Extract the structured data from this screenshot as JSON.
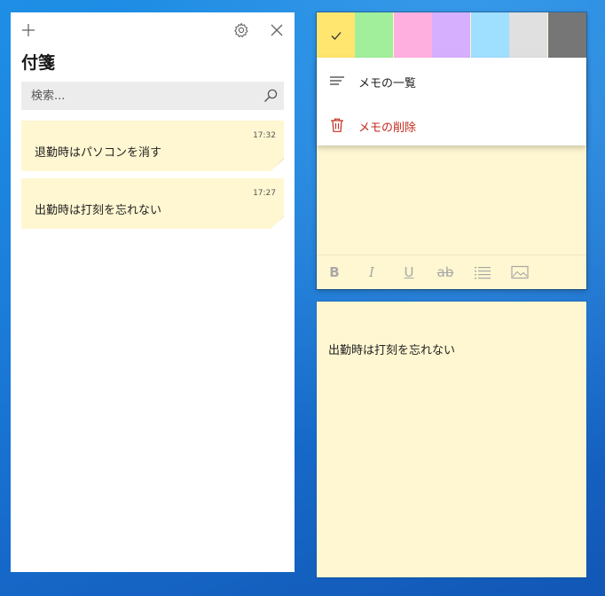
{
  "list_panel": {
    "title": "付箋",
    "search": {
      "placeholder": "検索...",
      "value": ""
    },
    "notes": [
      {
        "text": "退勤時はパソコンを消す",
        "time": "17:32"
      },
      {
        "text": "出勤時は打刻を忘れない",
        "time": "17:27"
      }
    ]
  },
  "edit_note": {
    "colors": [
      {
        "name": "yellow",
        "hex": "#ffe66e",
        "selected": true
      },
      {
        "name": "green",
        "hex": "#a1ef9b"
      },
      {
        "name": "pink",
        "hex": "#ffafdf"
      },
      {
        "name": "purple",
        "hex": "#d7afff"
      },
      {
        "name": "blue",
        "hex": "#9fdfff"
      },
      {
        "name": "gray",
        "hex": "#e0e0e0"
      },
      {
        "name": "charcoal",
        "hex": "#767676"
      }
    ],
    "menu": [
      {
        "label": "メモの一覧",
        "icon": "list-icon"
      },
      {
        "label": "メモの削除",
        "icon": "trash-icon"
      }
    ],
    "format_labels": {
      "bold": "B",
      "italic": "I",
      "underline": "U",
      "strike": "ab"
    }
  },
  "note_window_2": {
    "text": "出勤時は打刻を忘れない"
  },
  "theme": {
    "note_bg": "#fff7d1",
    "delete_red": "#c42b1c",
    "desktop_blue": "#1b7fda"
  }
}
